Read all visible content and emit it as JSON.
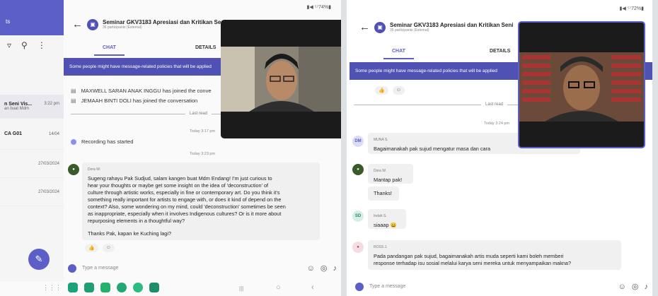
{
  "left": {
    "status": "▮◀ ⁵⁷74%▮",
    "sidebar": {
      "header": "ts",
      "items": [
        {
          "title": "n Seni Vis...",
          "time": "3:22 pm",
          "sub": "an buat Mdm"
        },
        {
          "title": "CA G01",
          "time": "14/04",
          "sub": ""
        },
        {
          "title": "",
          "time": "27/03/2024",
          "sub": ""
        },
        {
          "title": "",
          "time": "27/03/2024",
          "sub": ""
        }
      ],
      "fab": "✎"
    },
    "header": {
      "title": "Seminar GKV3183 Apresiasi dan Kritikan Seni",
      "subtitle": "35 participants (External)"
    },
    "tabs": {
      "chat": "CHAT",
      "details": "DETAILS"
    },
    "banner": "Some people might have message-related policies that will be applied",
    "system": [
      "MAXWELL SARAN ANAK INGGU has joined the conve",
      "JEMAAH BINTI DOLI has joined the conversation"
    ],
    "last_read": "Last read",
    "ts1": "Today 3:17 pm",
    "recording": "Recording has started",
    "ts2": "Today 3:23 pm",
    "message": {
      "sender": "Dora W.",
      "lines": [
        "Sugeng rahayu Pak Sudjud, salam kangen buat Mdm Endang! I'm just curious to",
        "hear your thoughts or maybe get some insight on the idea of 'deconstruction' of",
        "culture through artistic works, especially in fine or contemporary art. Do you think it's",
        "something really important for artists to engage with, or does it kind of depend on the",
        "context? Also, some wondering on my mind, could 'deconstruction' sometimes be seen",
        "as inappropriate, especially when it involves Indigenous cultures? Or is it more about",
        "repurposing elements in a thoughtful way?",
        "",
        "Thanks Pak, kapan ke Kuching lagi?"
      ]
    },
    "compose_placeholder": "Type a message",
    "nav": {
      "menu": "⋮⋮⋮",
      "home": "○",
      "back": "‹",
      "recents": "|||"
    }
  },
  "right": {
    "status": "▮◀ ⁵⁷72%▮",
    "header": {
      "title": "Seminar GKV3183 Apresiasi dan Kritikan Seni",
      "subtitle": "35 participants (External)"
    },
    "tabs": {
      "chat": "CHAT",
      "details": "DETAILS"
    },
    "banner": "Some people might have message-related policies that will be applied",
    "last_read": "Last read",
    "ts1": "Today 3:24 pm",
    "messages": [
      {
        "initials": "DM",
        "sender": "MUNA S.",
        "text": "Bagaimanakah pak sujud mengatur masa dan cara"
      },
      {
        "initials": "",
        "sender": "Dora W.",
        "text": "Mantap pak!"
      },
      {
        "initials": "",
        "sender": "",
        "text": "Thanks!"
      },
      {
        "initials": "SD",
        "sender": "Indah S.",
        "text": "siaaap 😄"
      },
      {
        "initials": "",
        "sender": "ROSS J.",
        "text": "Pada pandangan pak sujud, bagaimanakah artis muda seperti kami boleh memberi",
        "text2": "response terhadap isu sosial melalui karya seni mereka untuk menyampaikan makna?"
      }
    ],
    "compose_placeholder": "Type a message"
  }
}
